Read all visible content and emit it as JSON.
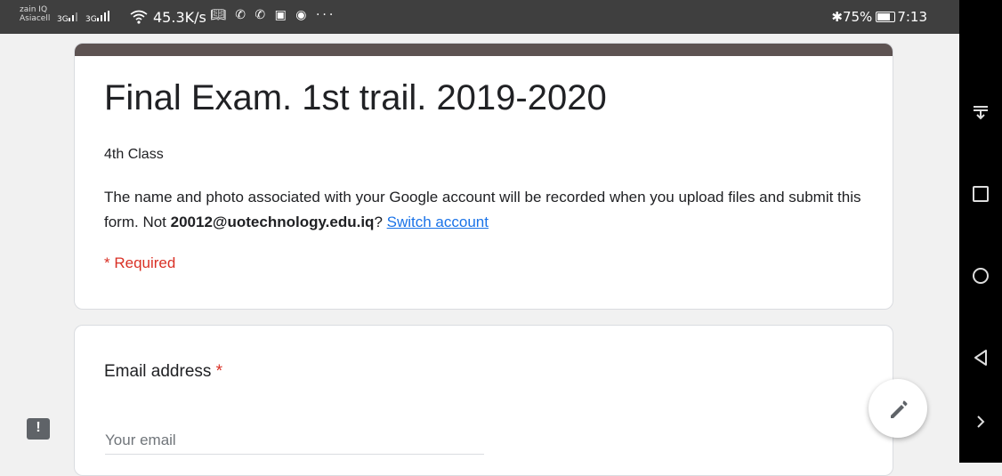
{
  "status_bar": {
    "carrier_line1": "zain IQ",
    "carrier_line2": "Asiacell",
    "signal1": "3G",
    "signal2": "3G",
    "network_speed": "45.3K/s",
    "notification_icons": [
      "book-icon",
      "viber-icon",
      "whatsapp-icon",
      "instagram-icon",
      "messenger-icon",
      "more-icon"
    ],
    "more": "···",
    "battery_percent": "75%",
    "time": "7:13",
    "bluetooth": "✱"
  },
  "form": {
    "title": "Final Exam. 1st trail. 2019-2020",
    "subtitle": "4th Class",
    "notice_text": "The name and photo associated with your Google account will be recorded when you upload files and submit this form. Not ",
    "account_email": "20012@uotechnology.edu.iq",
    "notice_suffix": "?",
    "switch_account": "Switch account",
    "required_note": "* Required",
    "header_color": "#5d5352"
  },
  "question": {
    "label": "Email address",
    "required_star": "*",
    "placeholder": "Your email"
  },
  "feedback_icon_glyph": "!"
}
